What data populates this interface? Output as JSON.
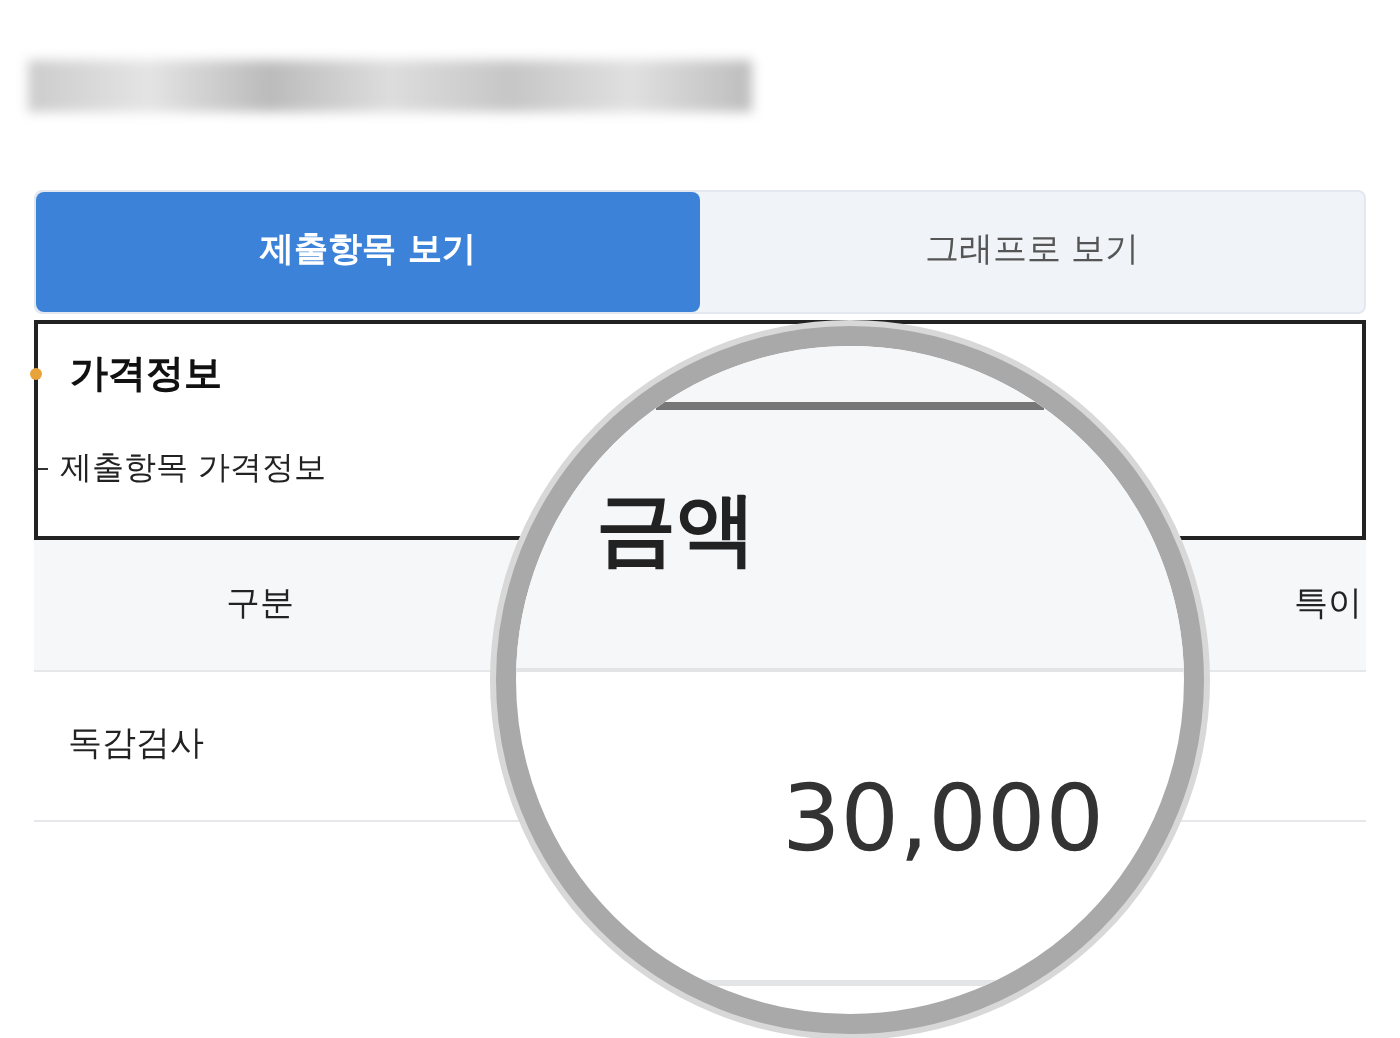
{
  "tabs": [
    {
      "label": "제출항목 보기",
      "selected": true
    },
    {
      "label": "그래프로 보기",
      "selected": false
    }
  ],
  "section": {
    "title": "가격정보",
    "subtitle": "제출항목 가격정보"
  },
  "table": {
    "columns": [
      "구분",
      "특이"
    ],
    "rows": [
      [
        "독감검사"
      ]
    ]
  },
  "magnifier": {
    "column": "금액",
    "value": "30,000"
  }
}
